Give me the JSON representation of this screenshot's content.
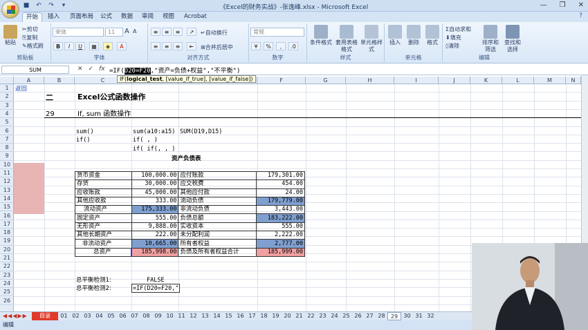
{
  "window": {
    "title": "《Excel的财务实战》-张逸峰.xlsx - Microsoft Excel"
  },
  "ribbon_tabs": [
    "开始",
    "插入",
    "页面布局",
    "公式",
    "数据",
    "审阅",
    "视图",
    "Acrobat"
  ],
  "clipboard": {
    "paste": "粘贴",
    "cut": "剪切",
    "copy": "复制",
    "format_painter": "格式刷",
    "label": "剪贴板"
  },
  "font": {
    "name": "宋体",
    "size": "11",
    "label": "字体",
    "bold": "B",
    "italic": "I",
    "underline": "U"
  },
  "alignment": {
    "wrap": "自动换行",
    "merge": "合并后居中",
    "label": "对齐方式"
  },
  "number": {
    "format": "常规",
    "label": "数字",
    "percent": "%"
  },
  "styles": {
    "conditional": "条件格式",
    "table": "套用表格格式",
    "cell": "单元格样式",
    "label": "样式"
  },
  "cells": {
    "insert": "插入",
    "delete": "删除",
    "format": "格式",
    "label": "单元格"
  },
  "editing": {
    "autosum": "自动求和",
    "fill": "填充",
    "clear": "清除",
    "sort": "排序和筛选",
    "find": "查找和选择",
    "label": "编辑"
  },
  "formula_bar": {
    "name_box": "SUM",
    "cancel": "✕",
    "enter": "✓",
    "fx": "fx",
    "formula_pre": "=IF(",
    "formula_hl": "D20=F20",
    "formula_post": ",\"资产=负债+权益\",\"不平衡\")",
    "tooltip_prefix": "IF(",
    "tooltip_arg1": "logical_test",
    "tooltip_rest": ", [value_if_true], [value_if_false])"
  },
  "columns": [
    "A",
    "B",
    "C",
    "D",
    "E",
    "F",
    "G",
    "H",
    "I",
    "J",
    "K",
    "L",
    "M",
    "N"
  ],
  "rows": [
    "1",
    "2",
    "3",
    "4",
    "5",
    "6",
    "7",
    "8",
    "9",
    "10",
    "11",
    "12",
    "13",
    "14",
    "15",
    "16",
    "17",
    "18",
    "19",
    "20",
    "21",
    "22",
    "23",
    "24",
    "25",
    "26"
  ],
  "sheet": {
    "a1": "返回",
    "b2": "二",
    "c2": "Excel公式函数操作",
    "b4": "29",
    "c4": "If, sum 函数操作",
    "c6": "sum()",
    "d6": "sum(a10:a15)",
    "e6": "SUM(D19,D15)",
    "c7": "if()",
    "d7": "if(    ,    )",
    "d8": "if( if(,  ,  )",
    "table_title": "资产负债表",
    "c23": "总平衡检测1:",
    "d23": "FALSE",
    "c24": "总平衡检测2:",
    "d24": "=IF(D20=F20,\""
  },
  "balance_sheet": [
    [
      "货币资金",
      "100,000.00",
      "应付账款",
      "179,301.00"
    ],
    [
      "存货",
      "30,000.00",
      "应交税费",
      "454.00"
    ],
    [
      "应收账款",
      "45,000.00",
      "其他应付款",
      "24.00"
    ],
    [
      "其他应收款",
      "333.00",
      "流动负债",
      "179,779.00"
    ],
    [
      "流动资产",
      "175,333.00",
      "非流动负债",
      "3,443.00"
    ],
    [
      "固定资产",
      "555.00",
      "负债总额",
      "183,222.00"
    ],
    [
      "无形资产",
      "9,888.00",
      "实收资本",
      "555.00"
    ],
    [
      "其他长期资产",
      "222.00",
      "未分配利润",
      "2,222.00"
    ],
    [
      "非流动资产",
      "10,665.00",
      "所有者权益",
      "2,777.00"
    ],
    [
      "总资产",
      "185,998.00",
      "负债及所有者权益合计",
      "185,999.00"
    ]
  ],
  "sheet_tabs": [
    "目录",
    "01",
    "02",
    "03",
    "04",
    "05",
    "06",
    "07",
    "08",
    "09",
    "10",
    "11",
    "12",
    "13",
    "14",
    "15",
    "16",
    "17",
    "18",
    "19",
    "20",
    "21",
    "22",
    "23",
    "24",
    "25",
    "26",
    "27",
    "28",
    "29",
    "30",
    "31",
    "32"
  ],
  "status": {
    "mode": "编辑"
  },
  "colors": {
    "accent_blue": "#7f9fcf",
    "accent_red": "#f0a0a0",
    "pink_block": "#e8b4b4"
  }
}
